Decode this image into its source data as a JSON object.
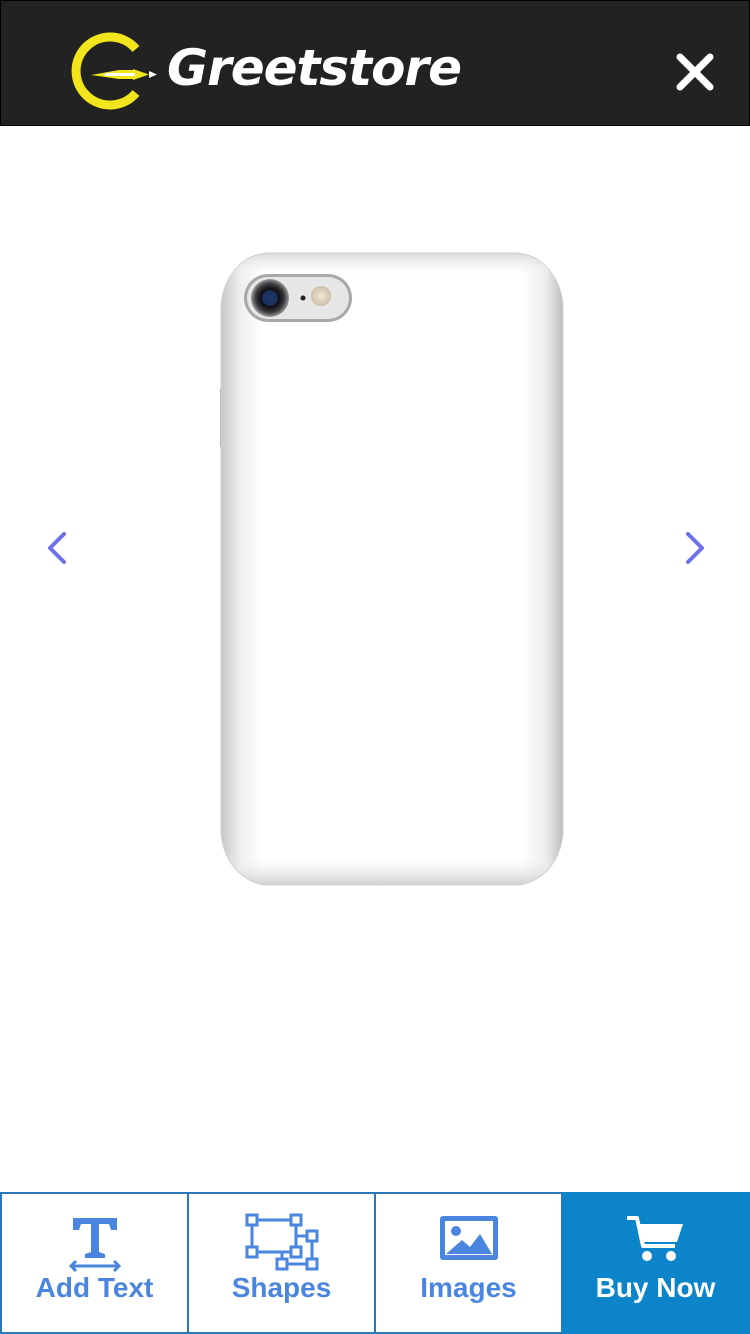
{
  "header": {
    "brand": "Greetstore",
    "close_label": "×",
    "colors": {
      "background": "#222222",
      "logo_accent": "#f2e51c",
      "text": "#ffffff"
    }
  },
  "preview": {
    "product": "phone-case",
    "prev_icon": "chevron-left-icon",
    "next_icon": "chevron-right-icon",
    "arrow_color": "#6f6ff0"
  },
  "toolbar": {
    "items": [
      {
        "label": "Add Text",
        "icon": "text-tool-icon"
      },
      {
        "label": "Shapes",
        "icon": "shapes-icon"
      },
      {
        "label": "Images",
        "icon": "image-icon"
      },
      {
        "label": "Buy Now",
        "icon": "cart-icon"
      }
    ],
    "colors": {
      "border": "#2b78b8",
      "label": "#4a86e0",
      "buy_background": "#0b84c9",
      "buy_label": "#ffffff"
    }
  }
}
